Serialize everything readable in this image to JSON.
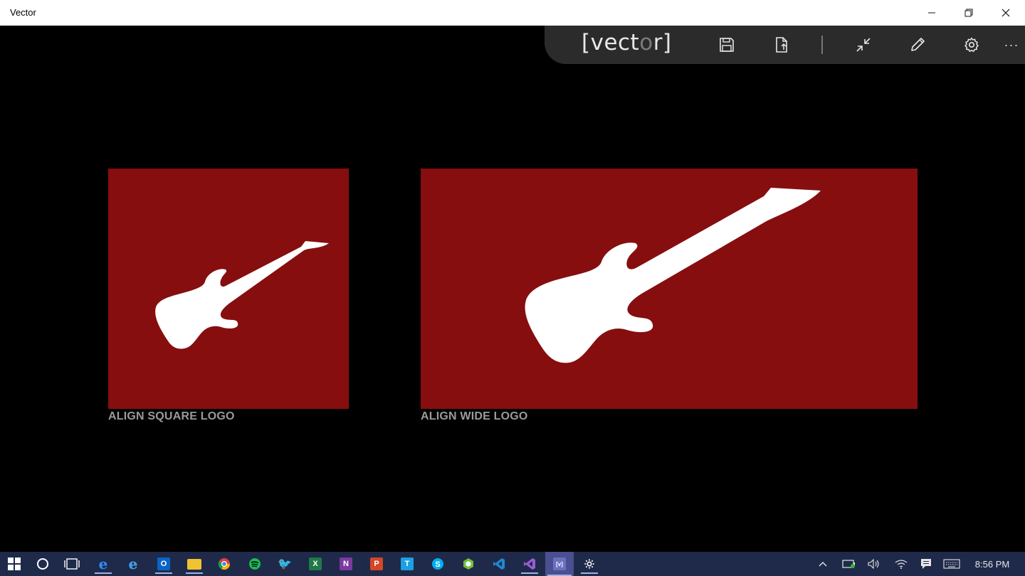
{
  "window": {
    "title": "Vector",
    "minimize_glyph": "—",
    "maximize_glyph": "❐",
    "close_glyph": "✕"
  },
  "toolbar": {
    "brand_open": "[vect",
    "brand_dim": "o",
    "brand_close": "r]",
    "icons": [
      "save-icon",
      "export-icon",
      "collapse-icon",
      "pencil-icon",
      "gear-icon",
      "more-icon"
    ],
    "more_glyph": "···"
  },
  "panels": {
    "square_label": "ALIGN SQUARE LOGO",
    "wide_label": "ALIGN WIDE LOGO",
    "background_color": "#860e0f",
    "logo_color": "#ffffff"
  },
  "taskbar": {
    "apps": [
      "windows-start",
      "cortana",
      "task-view",
      "edge",
      "internet-explorer",
      "outlook",
      "file-explorer",
      "chrome",
      "spotify",
      "twitter",
      "excel",
      "onenote",
      "powerpoint",
      "tfs",
      "skype",
      "app-hex",
      "visual-studio-code",
      "visual-studio",
      "vector",
      "settings"
    ],
    "time": "8:56 PM"
  }
}
